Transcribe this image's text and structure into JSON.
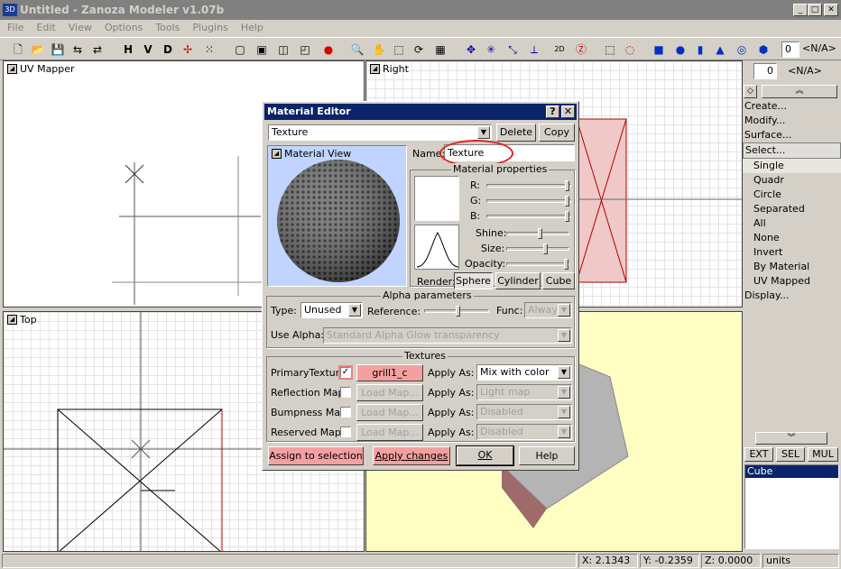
{
  "app": {
    "title": "Untitled - Zanoza Modeler v1.07b"
  },
  "menu": [
    "File",
    "Edit",
    "View",
    "Options",
    "Tools",
    "Plugins",
    "Help"
  ],
  "toolbar": {
    "h": "H",
    "v": "V",
    "d": "D",
    "spin_value": "0",
    "na": "<N/A>"
  },
  "viewports": {
    "uv": "UV Mapper",
    "right": "Right",
    "top": "Top"
  },
  "right_panel": {
    "spin_value": "0",
    "na": "<N/A>",
    "commands": [
      "Create...",
      "Modify...",
      "Surface...",
      "Select..."
    ],
    "select_items": [
      "Single",
      "Quadr",
      "Circle",
      "Separated",
      "All",
      "None",
      "Invert",
      "By Material",
      "UV Mapped"
    ],
    "display": "Display...",
    "tabs": [
      "EXT",
      "SEL",
      "MUL"
    ],
    "object_list": [
      "Cube"
    ]
  },
  "dialog": {
    "title": "Material Editor",
    "help_btn": "?",
    "close_btn": "✕",
    "material_select": "Texture",
    "delete_btn": "Delete",
    "copy_btn": "Copy",
    "material_view": "Material View",
    "name_label": "Name:",
    "name_value": "Texture",
    "props_title": "Material properties",
    "r": "R:",
    "g": "G:",
    "b": "B:",
    "shine": "Shine:",
    "size": "Size:",
    "opacity": "Opacity:",
    "render_label": "Render:",
    "render_buttons": [
      "Sphere",
      "Cylinder",
      "Cube"
    ],
    "alpha_title": "Alpha parameters",
    "type_label": "Type:",
    "type_value": "Unused",
    "reference_label": "Reference:",
    "func_label": "Func:",
    "func_value": "Always",
    "use_alpha_label": "Use Alpha:",
    "use_alpha_value": "Standard Alpha Glow transparency",
    "textures_title": "Textures",
    "texture_rows": [
      {
        "label": "PrimaryTexture",
        "btn": "grill1_c",
        "apply_label": "Apply As:",
        "apply_value": "Mix with color"
      },
      {
        "label": "Reflection Map",
        "btn": "Load Map...",
        "apply_label": "Apply As:",
        "apply_value": "Light map"
      },
      {
        "label": "Bumpness Map",
        "btn": "Load Map...",
        "apply_label": "Apply As:",
        "apply_value": "Disabled"
      },
      {
        "label": "Reserved Map",
        "btn": "Load Map...",
        "apply_label": "Apply As:",
        "apply_value": "Disabled"
      }
    ],
    "assign_btn": "Assign to selection",
    "apply_btn": "Apply changes",
    "ok_btn": "OK",
    "help2_btn": "Help"
  },
  "status": {
    "x": "X: 2.1343",
    "y": "Y: -0.2359",
    "z": "Z: 0.0000",
    "units": "units"
  }
}
